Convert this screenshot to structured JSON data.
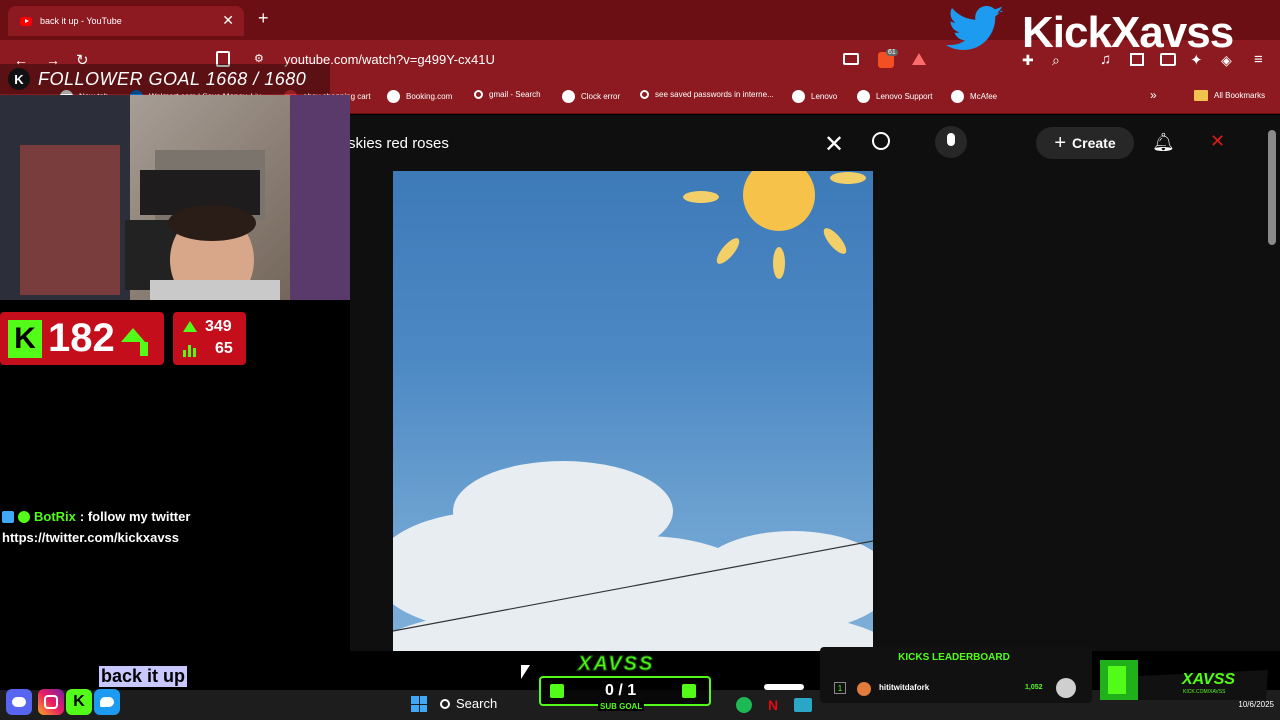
{
  "browser": {
    "tab_title": "back it up - YouTube",
    "url": "youtube.com/watch?v=g499Y-cx41U",
    "bookmarks": [
      "New tab",
      "Walmart.com | Save Money. Liv...",
      "ebay shopping cart",
      "Booking.com",
      "gmail - Search",
      "Clock error",
      "see saved passwords in interne...",
      "Lenovo",
      "Lenovo Support",
      "McAfee"
    ],
    "all_bookmarks": "All Bookmarks",
    "extension_badge": "61"
  },
  "youtube": {
    "search_query": "skies red roses",
    "create_label": "Create"
  },
  "overlay": {
    "follower_goal": "FOLLOWER GOAL 1668 / 1680",
    "kick_letter": "K",
    "kick_count": "182",
    "stat_top": "349",
    "stat_bottom": "65",
    "logo_text": "KickXavss",
    "chat_user": "BotRix",
    "chat_message": ": follow my twitter",
    "chat_link": "https://twitter.com/kickxavss",
    "now_playing": "back it up",
    "sub_goal_title": "XAVSS",
    "sub_goal_count": "0 / 1",
    "sub_goal_label": "SUB GOAL",
    "leaderboard_title": "KICKS LEADERBOARD",
    "leaderboard_rank": "1",
    "leaderboard_user": "hititwitdafork",
    "leaderboard_amount": "1,052",
    "brand_name": "XAVSS",
    "brand_sub": "KICK.COM/XAVSS"
  },
  "taskbar": {
    "search_label": "Search",
    "date": "10/6/2025"
  },
  "colors": {
    "browser_red": "#8c1a20",
    "kick_green": "#53fc18",
    "stat_red": "#c40e1c"
  }
}
